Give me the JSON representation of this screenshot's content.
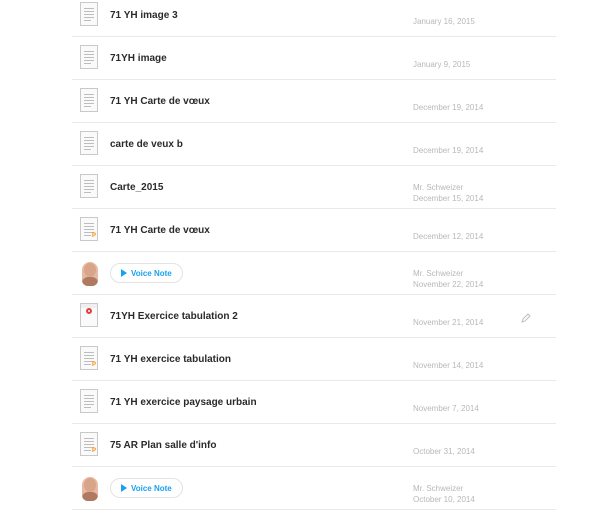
{
  "items": [
    {
      "kind": "doc",
      "thumb": "doc",
      "title": "71 YH image 3",
      "author": "",
      "date": "January 16, 2015"
    },
    {
      "kind": "doc",
      "thumb": "doc",
      "title": "71YH image",
      "author": "",
      "date": "January 9, 2015"
    },
    {
      "kind": "doc",
      "thumb": "doc",
      "title": "71 YH Carte de vœux",
      "author": "",
      "date": "December 19, 2014"
    },
    {
      "kind": "doc",
      "thumb": "doc",
      "title": "carte de veux b",
      "author": "",
      "date": "December 19, 2014"
    },
    {
      "kind": "doc",
      "thumb": "doc",
      "title": "Carte_2015",
      "author": "Mr. Schweizer",
      "date": "December 15, 2014"
    },
    {
      "kind": "doc",
      "thumb": "pages",
      "title": "71 YH Carte de vœux",
      "author": "",
      "date": "December 12, 2014"
    },
    {
      "kind": "voice",
      "voice_label": "Voice Note",
      "author": "Mr. Schweizer",
      "date": "November 22, 2014"
    },
    {
      "kind": "doc",
      "thumb": "drawing",
      "title": "71YH Exercice tabulation 2",
      "author": "",
      "date": "November 21, 2014",
      "editable": true
    },
    {
      "kind": "doc",
      "thumb": "pages",
      "title": "71 YH exercice tabulation",
      "author": "",
      "date": "November 14, 2014"
    },
    {
      "kind": "doc",
      "thumb": "doc",
      "title": "71 YH exercice paysage urbain",
      "author": "",
      "date": "November 7, 2014"
    },
    {
      "kind": "doc",
      "thumb": "pages",
      "title": "75 AR Plan salle d'info",
      "author": "",
      "date": "October 31, 2014"
    },
    {
      "kind": "voice",
      "voice_label": "Voice Note",
      "author": "Mr. Schweizer",
      "date": "October 10, 2014"
    }
  ],
  "icons": {
    "document": "document-thumbnail-icon",
    "pages": "pages-document-icon",
    "drawing": "drawing-thumbnail-icon",
    "play": "play-icon",
    "edit": "pencil-icon",
    "avatar": "avatar"
  },
  "colors": {
    "accent": "#1aa0f0",
    "pages_badge": "#ff8a00",
    "drawing_ring": "#e04040",
    "meta_text": "#b8b8b8",
    "divider": "#e9e9e9"
  }
}
